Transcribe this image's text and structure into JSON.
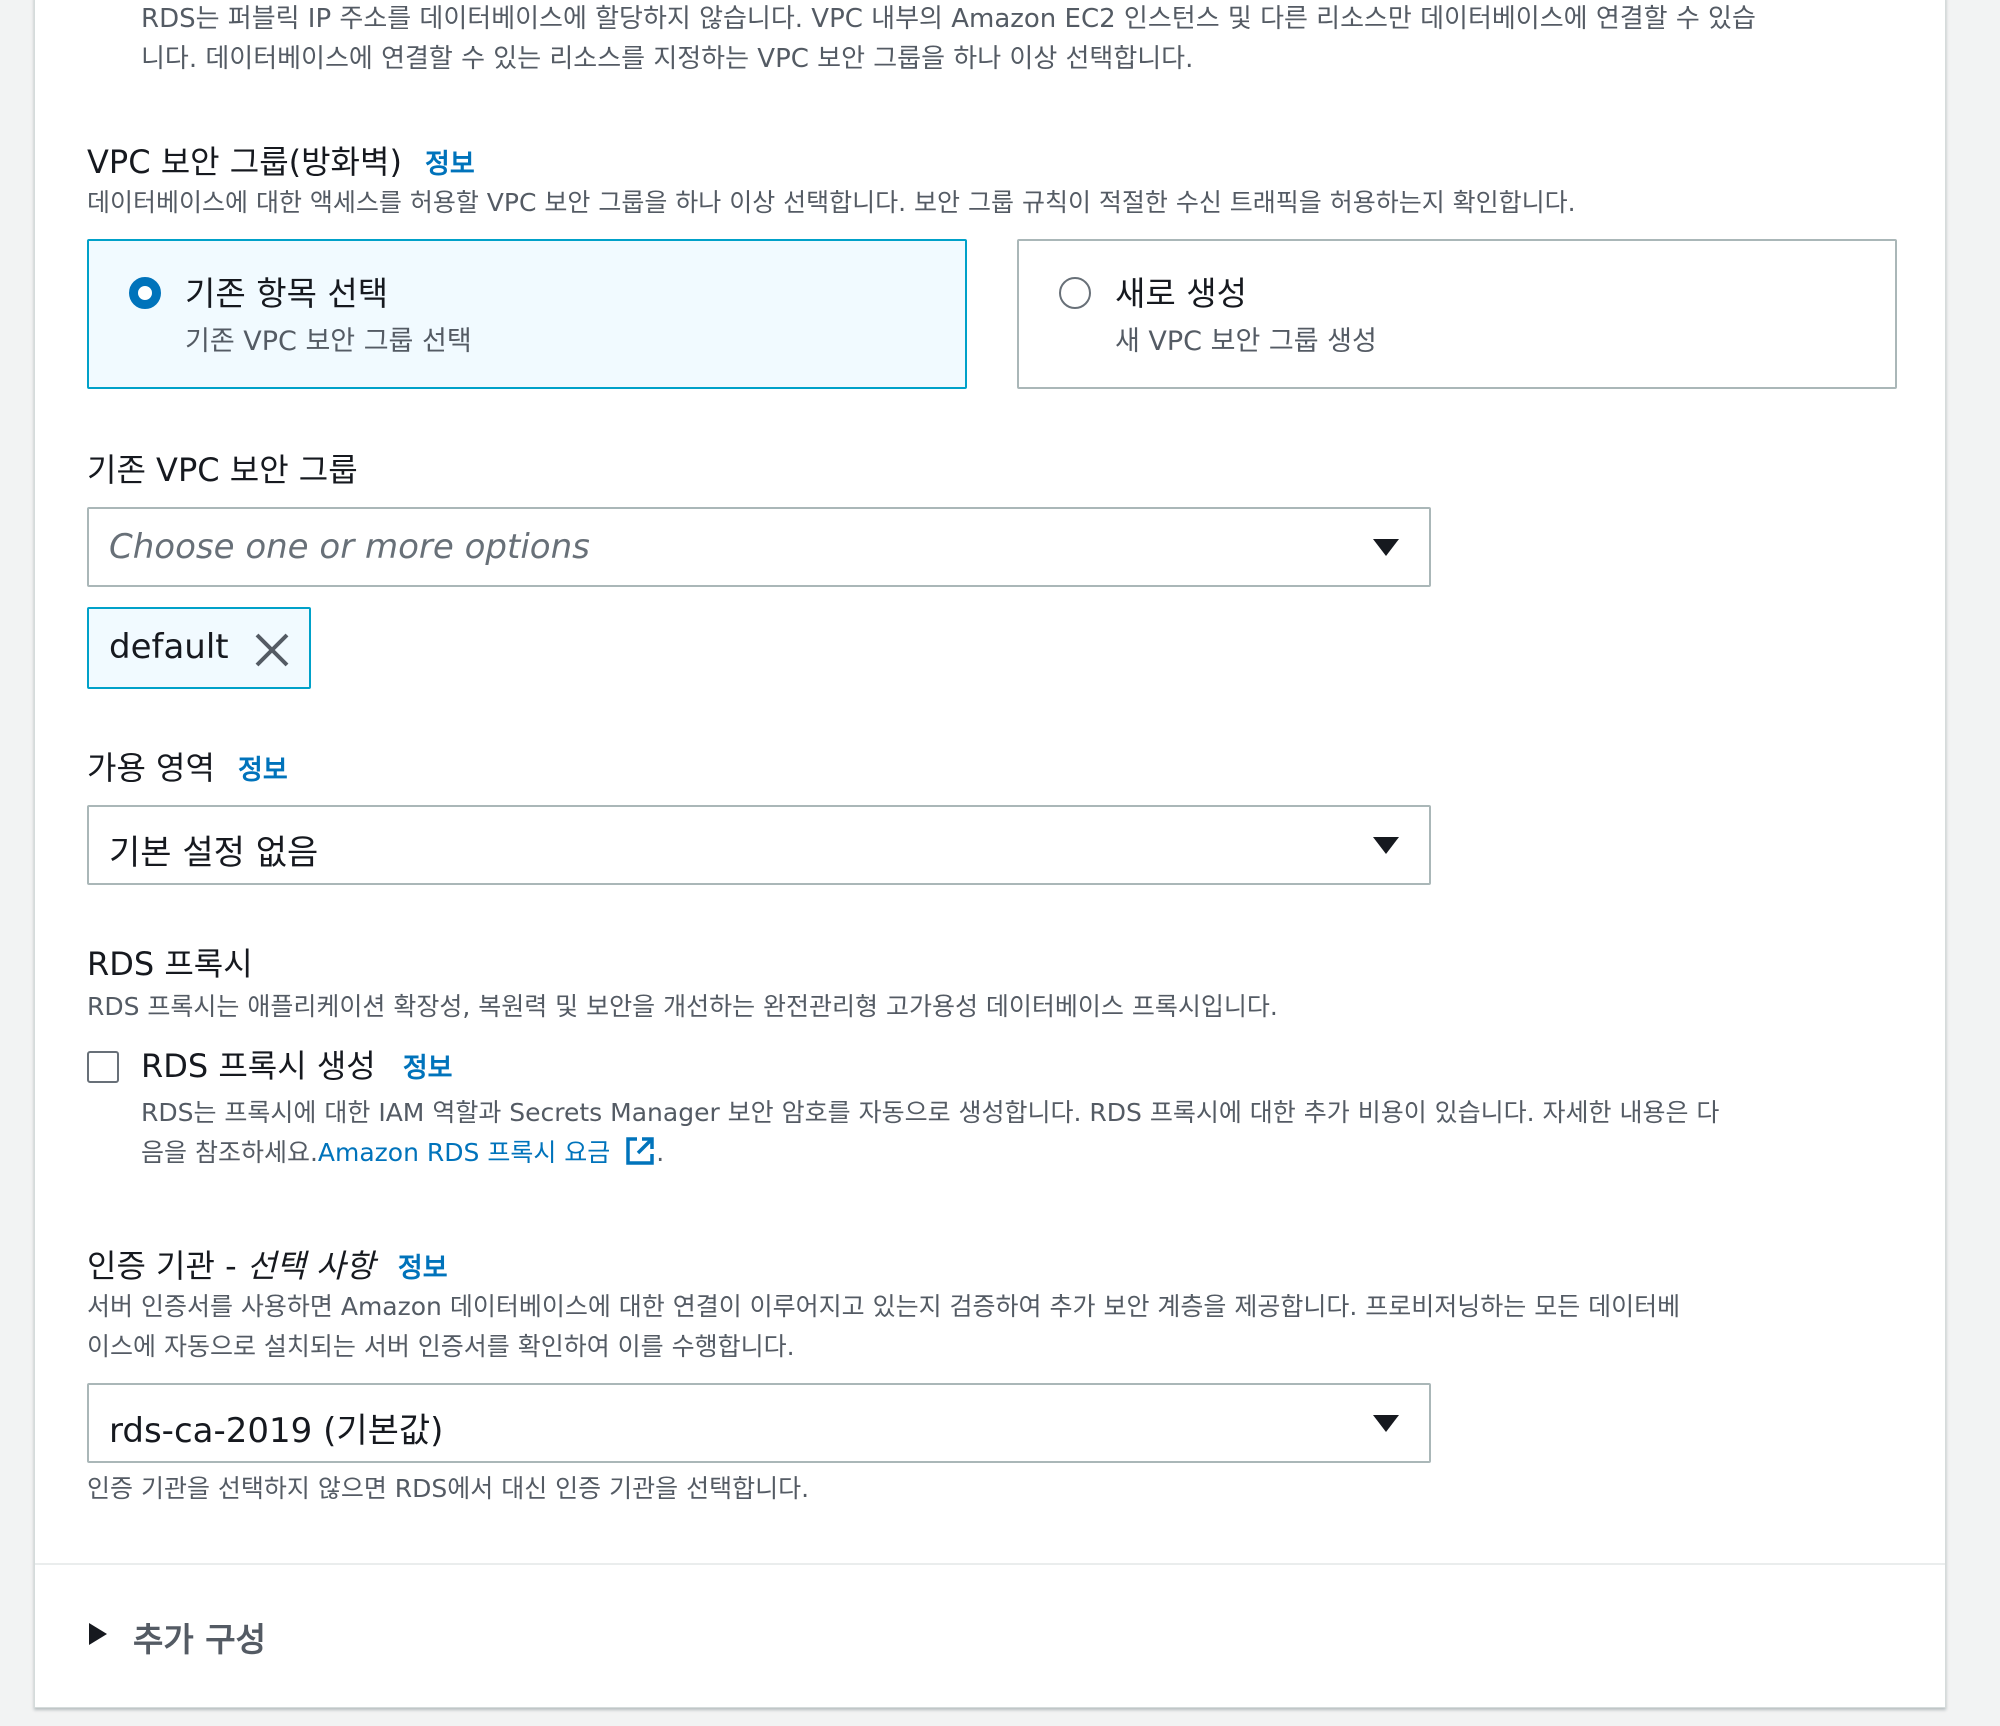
{
  "top_note": {
    "line1": "RDS는 퍼블릭 IP 주소를 데이터베이스에 할당하지 않습니다. VPC 내부의 Amazon EC2 인스턴스 및 다른 리소스만 데이터베이스에 연결할 수 있습",
    "line2": "니다. 데이터베이스에 연결할 수 있는 리소스를 지정하는 VPC 보안 그룹을 하나 이상 선택합니다."
  },
  "security_group": {
    "label": "VPC 보안 그룹(방화벽)",
    "info": "정보",
    "description": "데이터베이스에 대한 액세스를 허용할 VPC 보안 그룹을 하나 이상 선택합니다. 보안 그룹 규칙이 적절한 수신 트래픽을 허용하는지 확인합니다.",
    "options": [
      {
        "title": "기존 항목 선택",
        "subtitle": "기존 VPC 보안 그룹 선택",
        "selected": true
      },
      {
        "title": "새로 생성",
        "subtitle": "새 VPC 보안 그룹 생성",
        "selected": false
      }
    ]
  },
  "existing_sg": {
    "label": "기존 VPC 보안 그룹",
    "placeholder": "Choose one or more options",
    "tokens": [
      "default"
    ]
  },
  "availability_zone": {
    "label": "가용 영역",
    "info": "정보",
    "value": "기본 설정 없음"
  },
  "rds_proxy": {
    "heading": "RDS 프록시",
    "description": "RDS 프록시는 애플리케이션 확장성, 복원력 및 보안을 개선하는 완전관리형 고가용성 데이터베이스 프록시입니다.",
    "checkbox_label": "RDS 프록시 생성",
    "checked": false,
    "info": "정보",
    "note_line1": "RDS는 프록시에 대한 IAM 역할과 Secrets Manager 보안 암호를 자동으로 생성합니다. RDS 프록시에 대한 추가 비용이 있습니다. 자세한 내용은 다",
    "note_line2_prefix": "음을 참조하세요.",
    "note_link": "Amazon RDS 프록시 요금",
    "note_suffix": "."
  },
  "certificate_authority": {
    "label_main": "인증 기관 - ",
    "label_optional": "선택 사항",
    "info": "정보",
    "desc_line1": "서버 인증서를 사용하면 Amazon 데이터베이스에 대한 연결이 이루어지고 있는지 검증하여 추가 보안 계층을 제공합니다. 프로비저닝하는 모든 데이터베",
    "desc_line2": "이스에 자동으로 설치되는 서버 인증서를 확인하여 이를 수행합니다.",
    "value": "rds-ca-2019 (기본값)",
    "hint": "인증 기관을 선택하지 않으면 RDS에서 대신 인증 기관을 선택합니다."
  },
  "additional_config": {
    "label": "추가 구성"
  },
  "colors": {
    "link": "#0073bb",
    "selected_border": "#00a1c9",
    "selected_bg": "#f1faff"
  }
}
